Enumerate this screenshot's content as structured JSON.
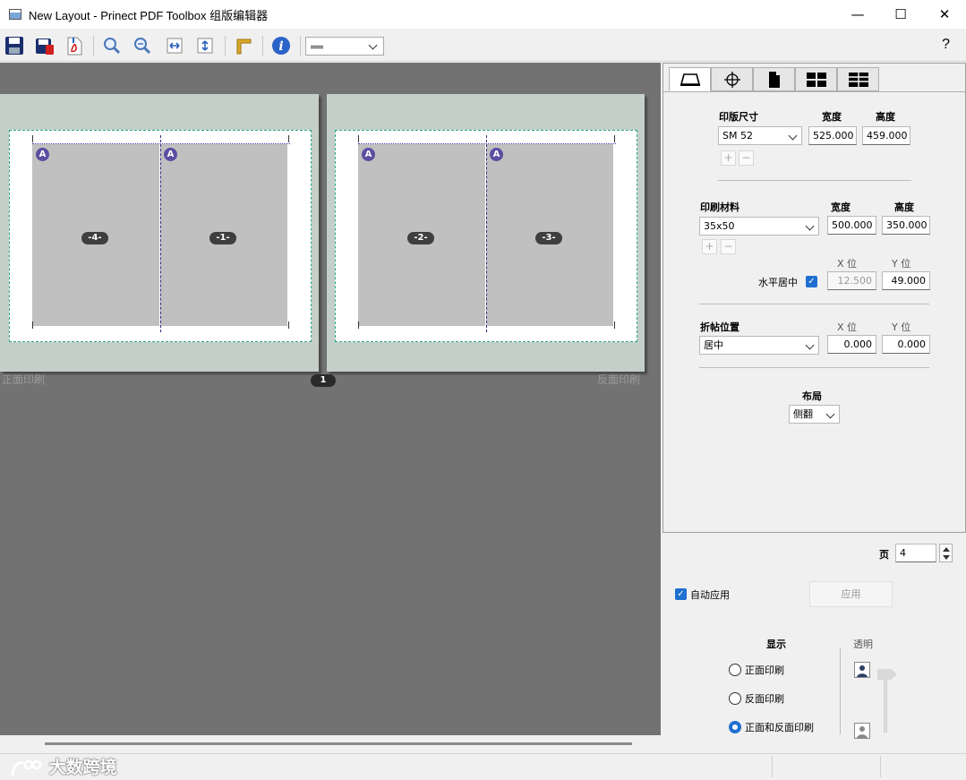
{
  "window": {
    "title": "New Layout - Prinect PDF Toolbox 组版编辑器",
    "minimize": "—",
    "maximize": "☐",
    "close": "✕"
  },
  "toolbar": {
    "help_label": "?",
    "line_select_value": ""
  },
  "canvas": {
    "sheet_number": "1",
    "front_label": "正面印刷",
    "back_label": "反面印刷",
    "mark_letter": "A",
    "front_pages": [
      "-4-",
      "-1-"
    ],
    "back_pages": [
      "-2-",
      "-3-"
    ]
  },
  "panel": {
    "plate_size": {
      "label": "印版尺寸",
      "width_label": "宽度",
      "height_label": "高度",
      "value": "SM 52",
      "width": "525.000",
      "height": "459.000"
    },
    "add_label": "+",
    "remove_label": "−",
    "paper": {
      "label": "印刷材料",
      "width_label": "宽度",
      "height_label": "高度",
      "value": "35x50",
      "width": "500.000",
      "height": "350.000",
      "x_label": "X 位",
      "y_label": "Y 位",
      "center_label": "水平居中",
      "x": "12.500",
      "y": "49.000"
    },
    "signature": {
      "label": "折帖位置",
      "x_label": "X 位",
      "y_label": "Y 位",
      "value": "居中",
      "x": "0.000",
      "y": "0.000"
    },
    "layout": {
      "label": "布局",
      "value": "侧翻"
    }
  },
  "bottom": {
    "page_label": "页",
    "page_value": "4",
    "auto_apply_label": "自动应用",
    "apply_label": "应用",
    "display_label": "显示",
    "transparent_label": "透明",
    "options": [
      "正面印刷",
      "反面印刷",
      "正面和反面印刷"
    ],
    "selected_index": 2
  },
  "status": {
    "watermark": "大数跨境"
  },
  "colors": {
    "accent": "#1f6fd0",
    "canvas": "#727272",
    "sheet": "#c3cfc8",
    "page": "#c0c0c0",
    "mark": "#5a4fa0"
  }
}
